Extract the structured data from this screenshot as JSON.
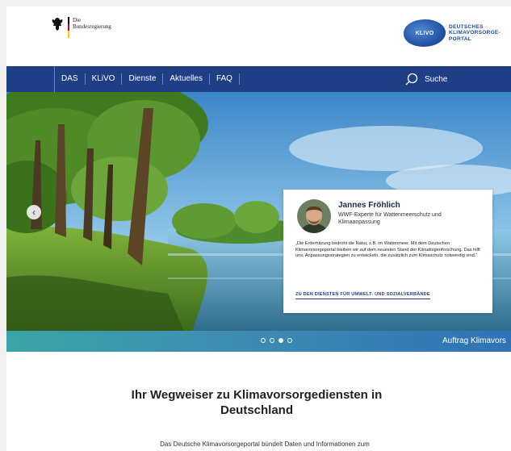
{
  "header": {
    "gov_logo_text_line1": "Die",
    "gov_logo_text_line2": "Bundesregierung",
    "klivo_badge": "KLIVO",
    "klivo_line1": "DEUTSCHES",
    "klivo_line2": "KLIMAVORSORGE-",
    "klivo_line3": "PORTAL"
  },
  "nav": {
    "items": [
      {
        "label": "DAS"
      },
      {
        "label": "KLiVO"
      },
      {
        "label": "Dienste"
      },
      {
        "label": "Aktuelles"
      },
      {
        "label": "FAQ"
      }
    ],
    "search_label": "Suche"
  },
  "hero": {
    "prev_arrow": "‹",
    "card": {
      "name": "Jannes Fröhlich",
      "role": "WWF-Experte für Wattenmeerschutz und Klimaanpassung",
      "quote": "„Die Erderhitzung bedroht die Natur, z.B. im Wattenmeer. Mit dem Deutschen Klimavorsorgeportal bleiben wir auf dem neuesten Stand der Klimafolgenforschung. Das hilft uns, Anpassungsstrategien zu entwickeln, die zusätzlich zum Klimaschutz notwendig sind.“",
      "link": "ZU DEN DIENSTEN FÜR UMWELT- UND SOZIALVERBÄNDE"
    }
  },
  "slider": {
    "active_index": 2,
    "dot_count": 4,
    "next_label": "Auftrag Klimavors"
  },
  "main": {
    "headline": "Ihr Wegweiser zu Klimavorsorgediensten in Deutschland",
    "intro": "Das Deutsche Klimavorsorgeportal bündelt Daten und Informationen zum"
  },
  "colors": {
    "nav_blue": "#1e3f86",
    "band_teal": "#3aa5a7"
  }
}
